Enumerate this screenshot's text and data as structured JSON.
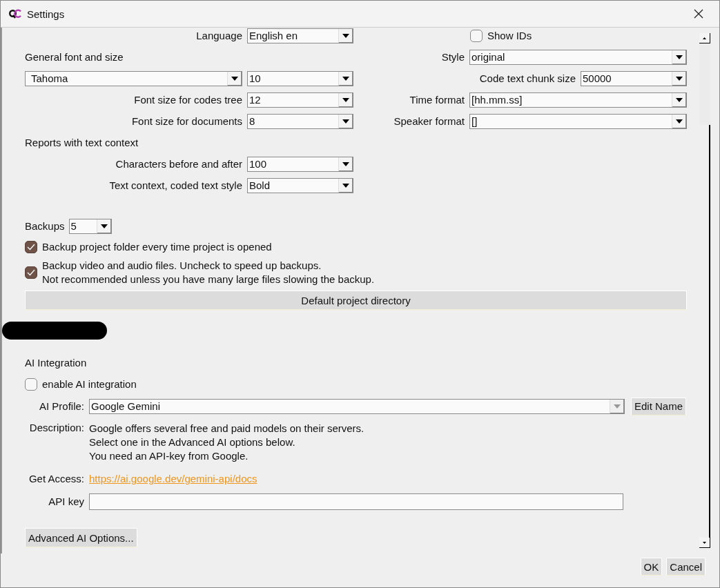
{
  "window": {
    "title": "Settings"
  },
  "language": {
    "label": "Language",
    "value": "English en"
  },
  "show_ids": {
    "label": "Show IDs",
    "checked": false
  },
  "general_font": {
    "label": "General font and size",
    "font": "Tahoma",
    "size": "10"
  },
  "left_fields": [
    {
      "label": "Font size for codes tree",
      "value": "12"
    },
    {
      "label": "Font size for documents",
      "value": "8"
    }
  ],
  "right_fields": [
    {
      "label": "Style",
      "value": "original",
      "kind": "wide"
    },
    {
      "label": "Code text chunk size",
      "value": "50000",
      "kind": "short"
    },
    {
      "label": "Time format",
      "value": "[hh.mm.ss]",
      "kind": "wide"
    },
    {
      "label": "Speaker format",
      "value": "[]",
      "kind": "wide"
    }
  ],
  "reports": {
    "heading": "Reports with text context",
    "fields": [
      {
        "label": "Characters before and after",
        "value": "100"
      },
      {
        "label": "Text context, coded text style",
        "value": "Bold"
      }
    ]
  },
  "backups": {
    "label": "Backups",
    "value": "5"
  },
  "backup_options": [
    {
      "label": "Backup project folder every time project is opened",
      "checked": true
    },
    {
      "label": "Backup video and audio files. Uncheck to speed up backups.\nNot recommended unless you have many large files slowing the backup.",
      "checked": true
    }
  ],
  "default_directory_button": "Default project directory",
  "ai": {
    "heading": "AI Integration",
    "enable": {
      "label": "enable AI integration",
      "checked": false
    },
    "profile": {
      "label": "AI Profile:",
      "value": "Google Gemini",
      "disabled": true
    },
    "edit_button": "Edit Name",
    "description_label": "Description:",
    "description": "Google offers several free and paid models on their servers.\nSelect one in the Advanced AI options below.\nYou need an API-key from Google.",
    "access_label": "Get Access:",
    "access_link": "https://ai.google.dev/gemini-api/docs",
    "api_key": {
      "label": "API key"
    },
    "advanced_button": "Advanced AI Options..."
  },
  "buttons": [
    "OK",
    "Cancel"
  ]
}
